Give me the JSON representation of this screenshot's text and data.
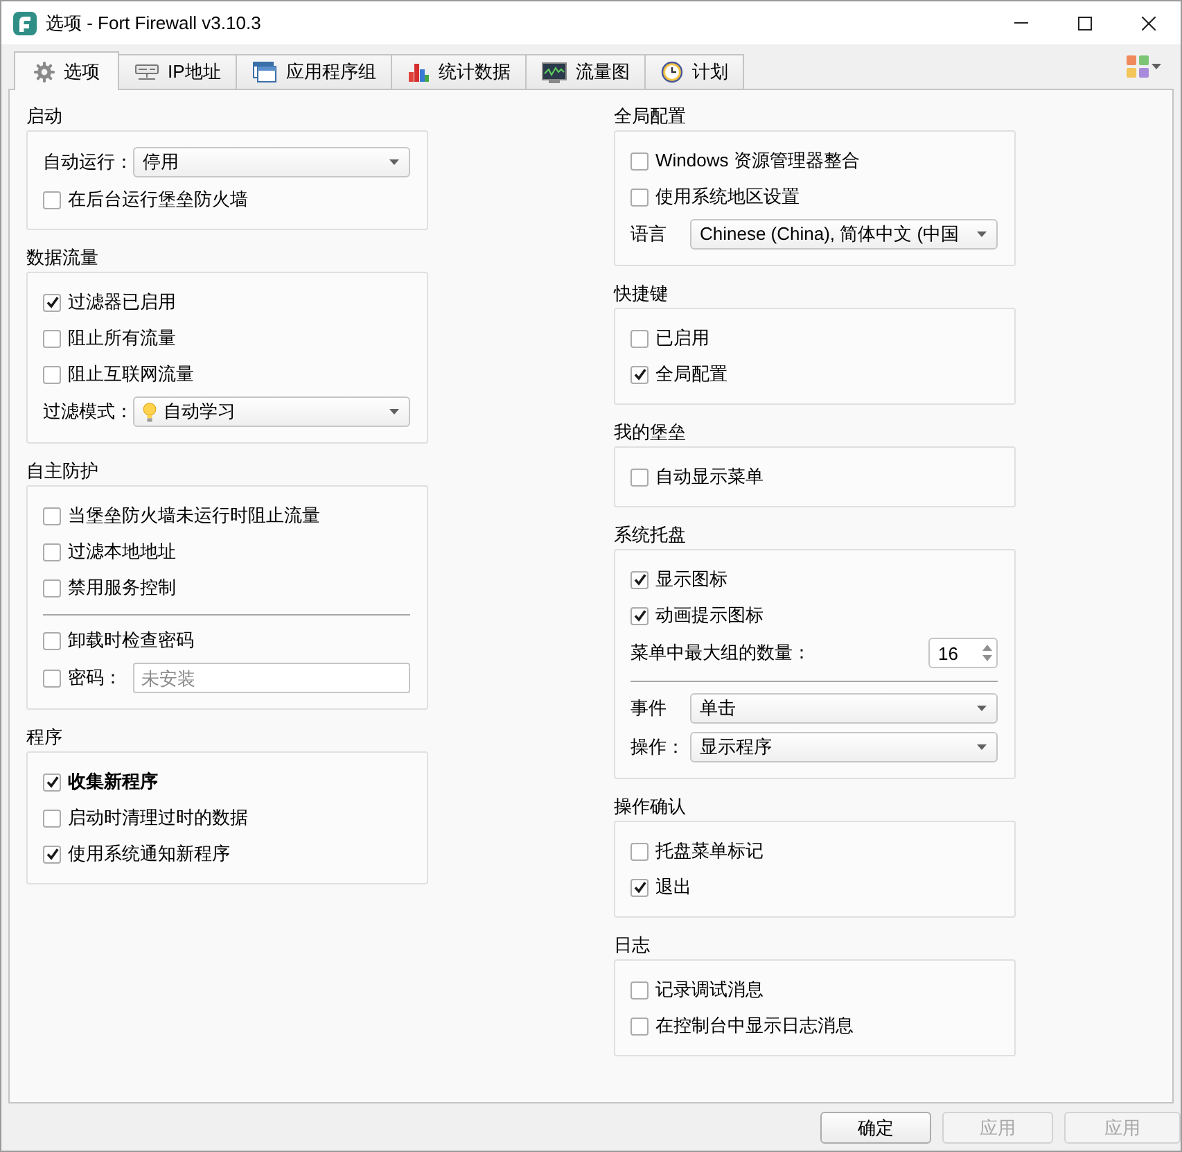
{
  "window": {
    "title": "选项 - Fort Firewall v3.10.3"
  },
  "tabs": [
    {
      "label": "选项",
      "selected": true
    },
    {
      "label": "IP地址",
      "selected": false
    },
    {
      "label": "应用程序组",
      "selected": false
    },
    {
      "label": "统计数据",
      "selected": false
    },
    {
      "label": "流量图",
      "selected": false
    },
    {
      "label": "计划",
      "selected": false
    }
  ],
  "left_column": [
    {
      "title": "启动",
      "rows": [
        {
          "kind": "combo",
          "label": "自动运行：",
          "value": "停用"
        },
        {
          "kind": "checkbox",
          "label": "在后台运行堡垒防火墙",
          "checked": false
        }
      ]
    },
    {
      "title": "数据流量",
      "rows": [
        {
          "kind": "checkbox",
          "label": "过滤器已启用",
          "checked": true
        },
        {
          "kind": "checkbox",
          "label": "阻止所有流量",
          "checked": false
        },
        {
          "kind": "checkbox",
          "label": "阻止互联网流量",
          "checked": false
        },
        {
          "kind": "icon_combo",
          "label": "过滤模式：",
          "value": "自动学习"
        }
      ]
    },
    {
      "title": "自主防护",
      "rows": [
        {
          "kind": "checkbox",
          "label": "当堡垒防火墙未运行时阻止流量",
          "checked": false
        },
        {
          "kind": "checkbox",
          "label": "过滤本地地址",
          "checked": false
        },
        {
          "kind": "checkbox",
          "label": "禁用服务控制",
          "checked": false
        },
        {
          "kind": "separator"
        },
        {
          "kind": "checkbox",
          "label": "卸载时检查密码",
          "checked": false
        },
        {
          "kind": "checkbox_field",
          "label": "密码：",
          "checked": false,
          "placeholder": "未安装"
        }
      ]
    },
    {
      "title": "程序",
      "rows": [
        {
          "kind": "checkbox",
          "label": "收集新程序",
          "checked": true,
          "bold": true
        },
        {
          "kind": "checkbox",
          "label": "启动时清理过时的数据",
          "checked": false
        },
        {
          "kind": "checkbox",
          "label": "使用系统通知新程序",
          "checked": true
        }
      ]
    }
  ],
  "right_column": [
    {
      "title": "全局配置",
      "rows": [
        {
          "kind": "checkbox",
          "label": "Windows 资源管理器整合",
          "checked": false
        },
        {
          "kind": "checkbox",
          "label": "使用系统地区设置",
          "checked": false
        },
        {
          "kind": "combo",
          "label": "语言",
          "value": "Chinese (China), 简体中文 (中国"
        }
      ]
    },
    {
      "title": "快捷键",
      "rows": [
        {
          "kind": "checkbox",
          "label": "已启用",
          "checked": false
        },
        {
          "kind": "checkbox",
          "label": "全局配置",
          "checked": true
        }
      ]
    },
    {
      "title": "我的堡垒",
      "rows": [
        {
          "kind": "checkbox",
          "label": "自动显示菜单",
          "checked": false
        }
      ]
    },
    {
      "title": "系统托盘",
      "rows": [
        {
          "kind": "checkbox",
          "label": "显示图标",
          "checked": true
        },
        {
          "kind": "checkbox",
          "label": "动画提示图标",
          "checked": true
        },
        {
          "kind": "spinbox",
          "label": "菜单中最大组的数量：",
          "value": "16"
        },
        {
          "kind": "separator"
        },
        {
          "kind": "combo",
          "label": "事件",
          "value": "单击"
        },
        {
          "kind": "combo",
          "label": "操作：",
          "value": "显示程序"
        }
      ]
    },
    {
      "title": "操作确认",
      "rows": [
        {
          "kind": "checkbox",
          "label": "托盘菜单标记",
          "checked": false
        },
        {
          "kind": "checkbox",
          "label": "退出",
          "checked": true
        }
      ]
    },
    {
      "title": "日志",
      "rows": [
        {
          "kind": "checkbox",
          "label": "记录调试消息",
          "checked": false
        },
        {
          "kind": "checkbox",
          "label": "在控制台中显示日志消息",
          "checked": false
        }
      ]
    }
  ],
  "buttons": [
    {
      "label": "确定",
      "disabled": false
    },
    {
      "label": "应用",
      "disabled": true
    },
    {
      "label": "应用",
      "disabled": true
    }
  ]
}
